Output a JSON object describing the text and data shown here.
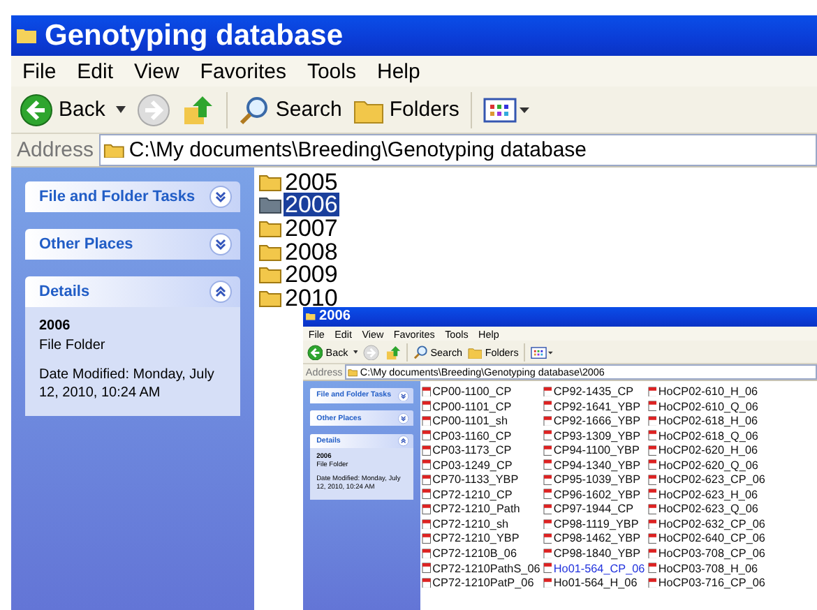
{
  "windows": [
    {
      "title": "Genotyping database",
      "menu": [
        "File",
        "Edit",
        "View",
        "Favorites",
        "Tools",
        "Help"
      ],
      "toolbar": {
        "back": "Back",
        "search": "Search",
        "folders": "Folders"
      },
      "address": {
        "label": "Address",
        "path": "C:\\My documents\\Breeding\\Genotyping database"
      },
      "panels": [
        {
          "title": "File and Folder Tasks",
          "expanded": false
        },
        {
          "title": "Other Places",
          "expanded": false
        },
        {
          "title": "Details",
          "expanded": true,
          "name": "2006",
          "type": "File Folder",
          "modified": "Date Modified: Monday, July 12, 2010, 10:24 AM"
        }
      ],
      "folders": [
        {
          "name": "2005",
          "selected": false
        },
        {
          "name": "2006",
          "selected": true
        },
        {
          "name": "2007",
          "selected": false
        },
        {
          "name": "2008",
          "selected": false
        },
        {
          "name": "2009",
          "selected": false
        },
        {
          "name": "2010",
          "selected": false
        }
      ]
    },
    {
      "title": "2006",
      "menu": [
        "File",
        "Edit",
        "View",
        "Favorites",
        "Tools",
        "Help"
      ],
      "toolbar": {
        "back": "Back",
        "search": "Search",
        "folders": "Folders"
      },
      "address": {
        "label": "Address",
        "path": "C:\\My documents\\Breeding\\Genotyping database\\2006"
      },
      "panels": [
        {
          "title": "File and Folder Tasks",
          "expanded": false
        },
        {
          "title": "Other Places",
          "expanded": false
        },
        {
          "title": "Details",
          "expanded": true,
          "name": "2006",
          "type": "File Folder",
          "modified": "Date Modified: Monday, July 12, 2010, 10:24 AM"
        }
      ],
      "file_columns": [
        [
          {
            "name": "CP00-1100_CP",
            "hover": false
          },
          {
            "name": "CP00-1101_CP",
            "hover": false
          },
          {
            "name": "CP00-1101_sh",
            "hover": false
          },
          {
            "name": "CP03-1160_CP",
            "hover": false
          },
          {
            "name": "CP03-1173_CP",
            "hover": false
          },
          {
            "name": "CP03-1249_CP",
            "hover": false
          },
          {
            "name": "CP70-1133_YBP",
            "hover": false
          },
          {
            "name": "CP72-1210_CP",
            "hover": false
          },
          {
            "name": "CP72-1210_Path",
            "hover": false
          },
          {
            "name": "CP72-1210_sh",
            "hover": false
          },
          {
            "name": "CP72-1210_YBP",
            "hover": false
          },
          {
            "name": "CP72-1210B_06",
            "hover": false
          },
          {
            "name": "CP72-1210PathS_06",
            "hover": false
          },
          {
            "name": "CP72-1210PatP_06",
            "hover": false
          }
        ],
        [
          {
            "name": "CP92-1435_CP",
            "hover": false
          },
          {
            "name": "CP92-1641_YBP",
            "hover": false
          },
          {
            "name": "CP92-1666_YBP",
            "hover": false
          },
          {
            "name": "CP93-1309_YBP",
            "hover": false
          },
          {
            "name": "CP94-1100_YBP",
            "hover": false
          },
          {
            "name": "CP94-1340_YBP",
            "hover": false
          },
          {
            "name": "CP95-1039_YBP",
            "hover": false
          },
          {
            "name": "CP96-1602_YBP",
            "hover": false
          },
          {
            "name": "CP97-1944_CP",
            "hover": false
          },
          {
            "name": "CP98-1119_YBP",
            "hover": false
          },
          {
            "name": "CP98-1462_YBP",
            "hover": false
          },
          {
            "name": "CP98-1840_YBP",
            "hover": false
          },
          {
            "name": "Ho01-564_CP_06",
            "hover": true
          },
          {
            "name": "Ho01-564_H_06",
            "hover": false
          }
        ],
        [
          {
            "name": "HoCP02-610_H_06",
            "hover": false
          },
          {
            "name": "HoCP02-610_Q_06",
            "hover": false
          },
          {
            "name": "HoCP02-618_H_06",
            "hover": false
          },
          {
            "name": "HoCP02-618_Q_06",
            "hover": false
          },
          {
            "name": "HoCP02-620_H_06",
            "hover": false
          },
          {
            "name": "HoCP02-620_Q_06",
            "hover": false
          },
          {
            "name": "HoCP02-623_CP_06",
            "hover": false
          },
          {
            "name": "HoCP02-623_H_06",
            "hover": false
          },
          {
            "name": "HoCP02-623_Q_06",
            "hover": false
          },
          {
            "name": "HoCP02-632_CP_06",
            "hover": false
          },
          {
            "name": "HoCP02-640_CP_06",
            "hover": false
          },
          {
            "name": "HoCP03-708_CP_06",
            "hover": false
          },
          {
            "name": "HoCP03-708_H_06",
            "hover": false
          },
          {
            "name": "HoCP03-716_CP_06",
            "hover": false
          }
        ]
      ]
    }
  ]
}
